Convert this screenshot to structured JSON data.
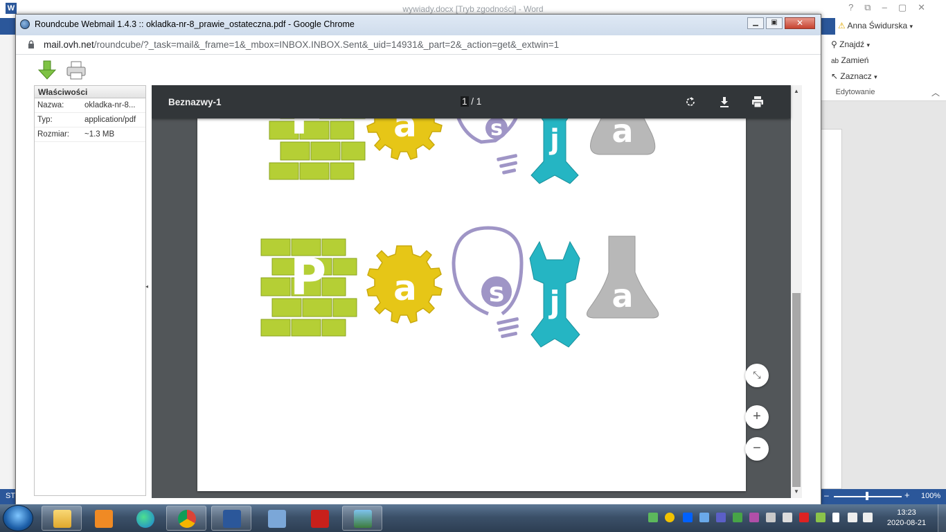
{
  "word": {
    "title": "wywiady.docx [Tryb zgodności] - Word",
    "user": "Anna Świdurska",
    "edit_find": "Znajdź",
    "edit_replace": "Zamień",
    "edit_select": "Zaznacz",
    "edit_group_label": "Edytowanie",
    "status_left": "ST",
    "zoom": "100%"
  },
  "chrome": {
    "title": "Roundcube Webmail 1.4.3 :: okladka-nr-8_prawie_ostateczna.pdf - Google Chrome",
    "url_host": "mail.ovh.net",
    "url_path": "/roundcube/?_task=mail&_frame=1&_mbox=INBOX.INBOX.Sent&_uid=14931&_part=2&_action=get&_extwin=1"
  },
  "properties": {
    "header": "Właściwości",
    "rows": [
      {
        "key": "Nazwa:",
        "value": "okladka-nr-8..."
      },
      {
        "key": "Typ:",
        "value": "application/pdf"
      },
      {
        "key": "Rozmiar:",
        "value": "~1.3 MB"
      }
    ]
  },
  "pdf": {
    "title": "Beznazwy-1",
    "current_page": "1",
    "total_pages": "/ 1",
    "logo_letters": [
      "P",
      "a",
      "s",
      "j",
      "a"
    ]
  },
  "taskbar": {
    "time": "13:23",
    "date": "2020-08-21"
  },
  "colors": {
    "brick_green": "#b5cf35",
    "gear_yellow": "#e6c617",
    "bulb_purple": "#9f95c6",
    "wrench_teal": "#25b5c3",
    "flask_gray": "#b8b8b8",
    "word_blue": "#2b579a"
  }
}
